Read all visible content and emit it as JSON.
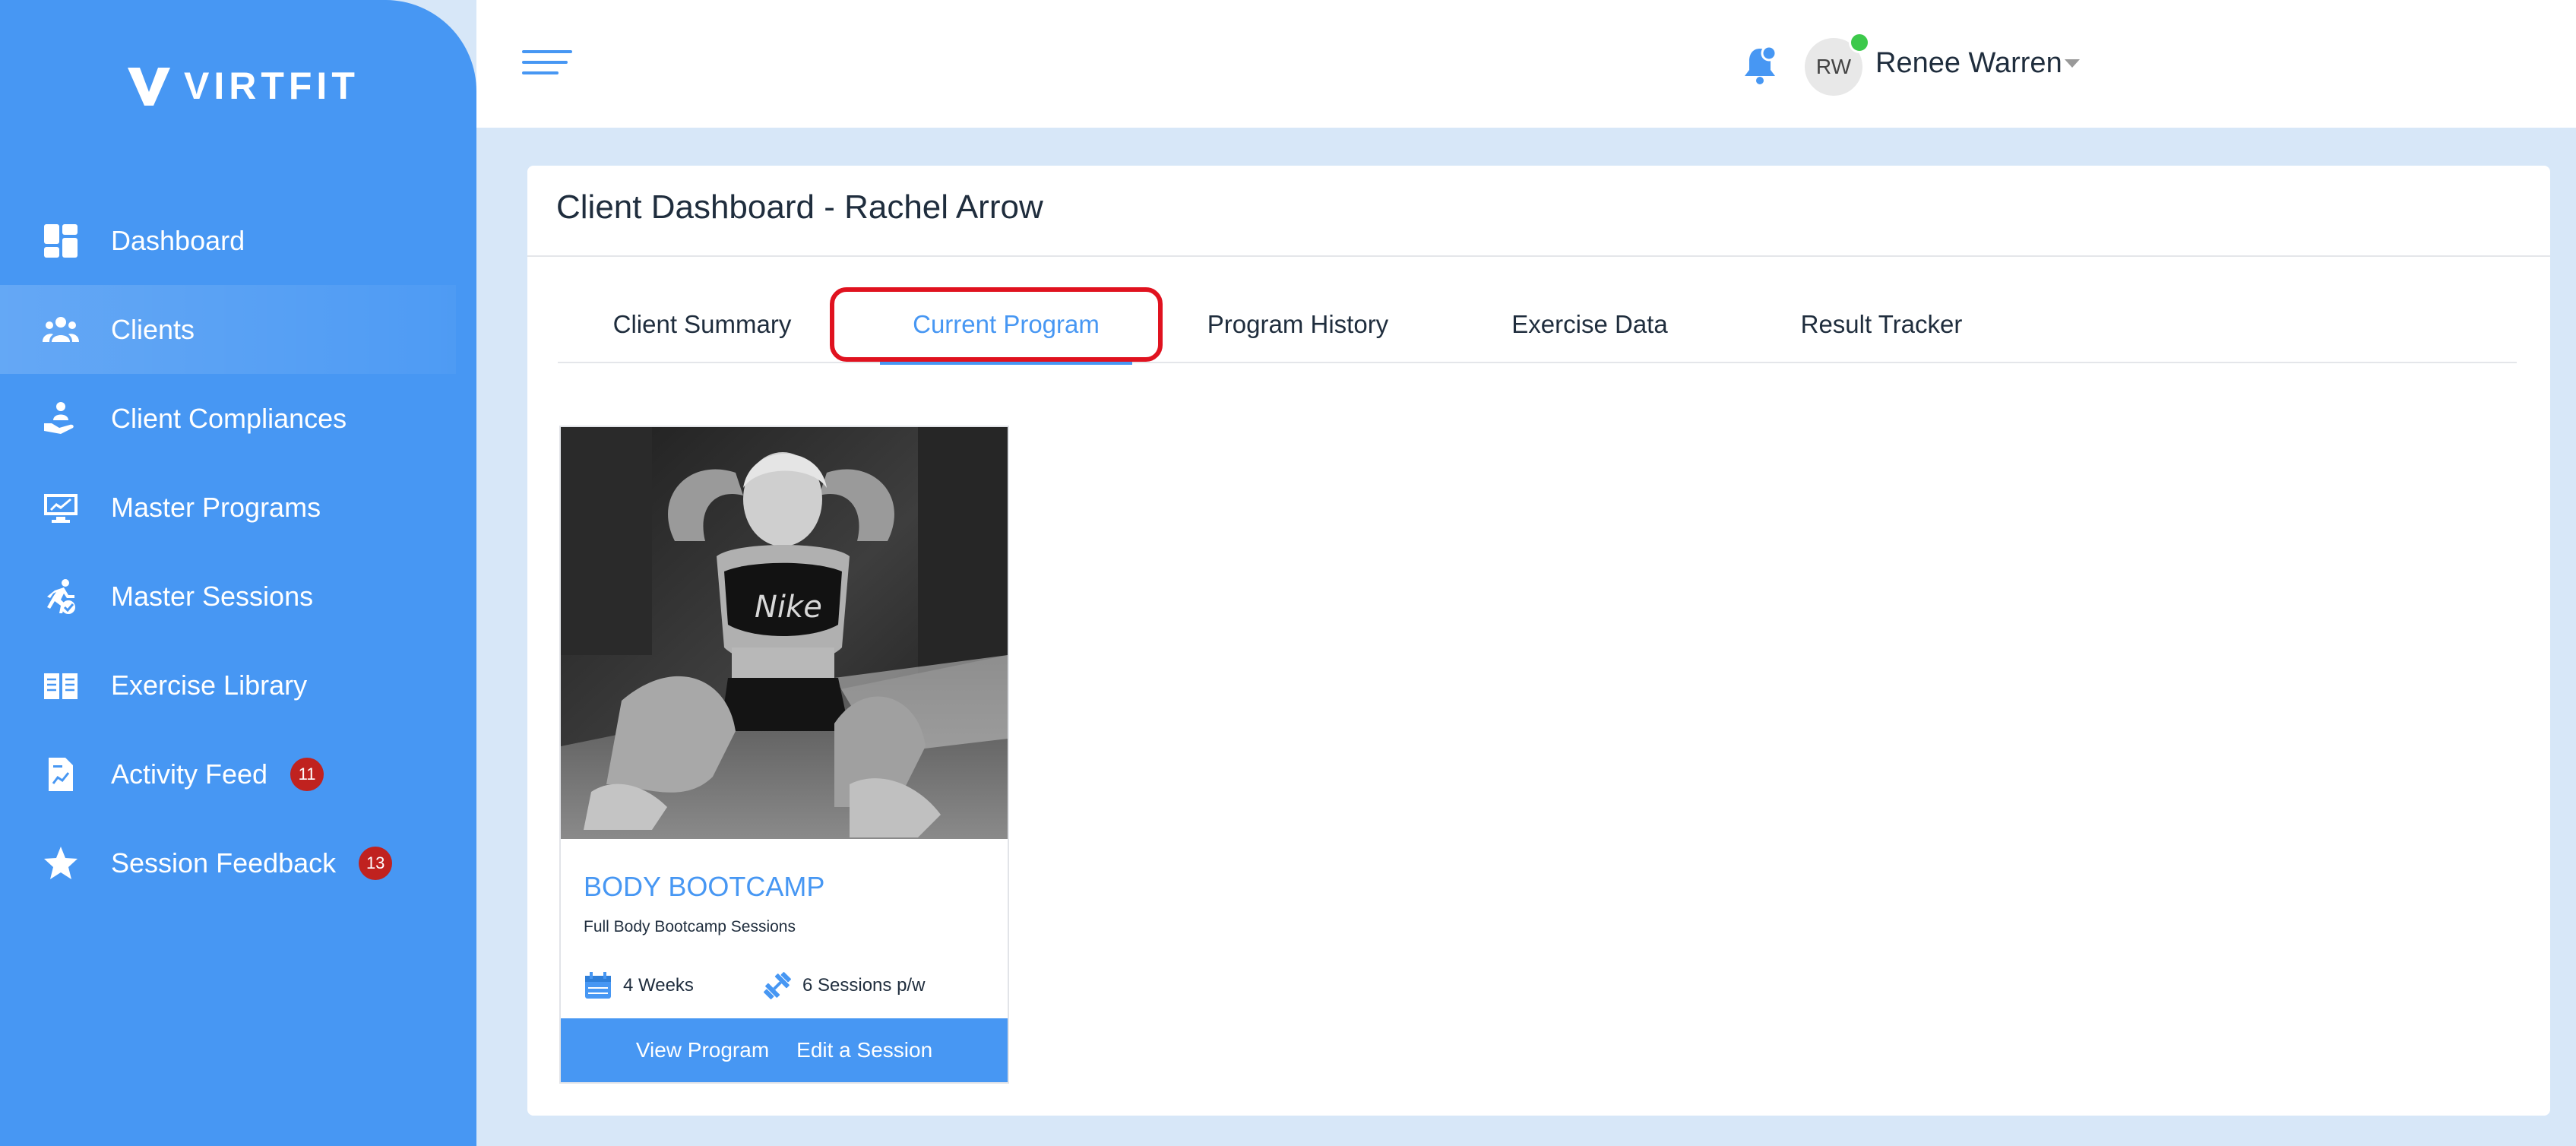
{
  "brand": {
    "name": "VIRTFIT"
  },
  "sidebar": {
    "items": [
      {
        "label": "Dashboard",
        "icon": "dashboard-icon"
      },
      {
        "label": "Clients",
        "icon": "users-icon",
        "active": true
      },
      {
        "label": "Client Compliances",
        "icon": "hand-person-icon"
      },
      {
        "label": "Master Programs",
        "icon": "monitor-chart-icon"
      },
      {
        "label": "Master Sessions",
        "icon": "running-check-icon"
      },
      {
        "label": "Exercise Library",
        "icon": "book-icon"
      },
      {
        "label": "Activity Feed",
        "icon": "document-chart-icon",
        "badge": "11"
      },
      {
        "label": "Session Feedback",
        "icon": "star-icon",
        "badge": "13"
      }
    ]
  },
  "header": {
    "user_initials": "RW",
    "user_name": "Renee Warren"
  },
  "page": {
    "title": "Client Dashboard - Rachel Arrow",
    "tabs": [
      {
        "label": "Client Summary"
      },
      {
        "label": "Current Program",
        "active": true
      },
      {
        "label": "Program History"
      },
      {
        "label": "Exercise Data"
      },
      {
        "label": "Result Tracker"
      }
    ]
  },
  "program": {
    "name": "BODY BOOTCAMP",
    "subtitle": "Full Body Bootcamp Sessions",
    "duration": "4 Weeks",
    "frequency": "6 Sessions p/w",
    "view_label": "View Program",
    "edit_label": "Edit a Session"
  },
  "colors": {
    "primary": "#4797f3",
    "badge": "#c0221f",
    "highlight": "#e0121f",
    "online": "#3cc94b"
  }
}
